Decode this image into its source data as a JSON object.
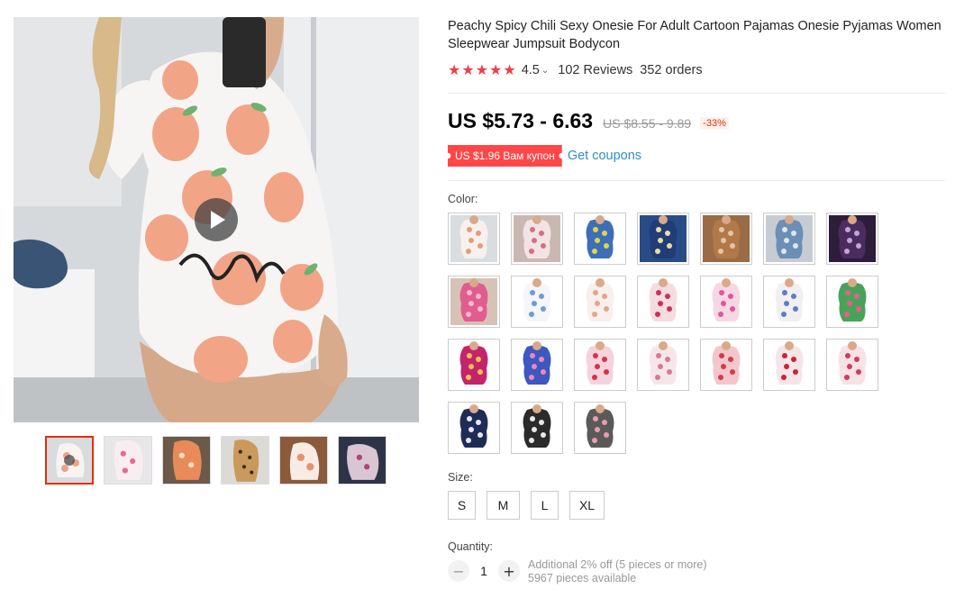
{
  "product": {
    "title": "Peachy Spicy Chili Sexy Onesie For Adult Cartoon Pajamas Onesie Pyjamas Women Sleepwear Jumpsuit Bodycon",
    "rating": "4.5",
    "rating_caret": "⌄",
    "reviews": "102 Reviews",
    "orders": "352 orders",
    "price": "US $5.73 - 6.63",
    "old_price": "US $8.55 - 9.89",
    "discount": "-33%",
    "coupon_badge": "US $1.96 Вам купон",
    "coupon_link": "Get coupons"
  },
  "gallery": {
    "main_image": "peach-print-onesie-photo",
    "play_icon": "play-icon",
    "thumbnails": [
      {
        "name": "peach-white"
      },
      {
        "name": "pink-hearts"
      },
      {
        "name": "orange-pattern"
      },
      {
        "name": "leopard"
      },
      {
        "name": "peach-brown"
      },
      {
        "name": "dark-floral"
      }
    ]
  },
  "options": {
    "color_label": "Color:",
    "colors": [
      {
        "name": "peach-white",
        "main": "#f6f1ee",
        "accent": "#e99a7d",
        "bg": "#d9dde0"
      },
      {
        "name": "pink-print",
        "main": "#f2e4e4",
        "accent": "#d86f7e",
        "bg": "#c9b8b2"
      },
      {
        "name": "blue-floral",
        "main": "#3b6fb8",
        "accent": "#e7d24a",
        "bg": "#ffffff"
      },
      {
        "name": "navy-pattern",
        "main": "#1f3e78",
        "accent": "#f0d9a8",
        "bg": "#2a4c86"
      },
      {
        "name": "brown-floral",
        "main": "#b27948",
        "accent": "#e7c4a1",
        "bg": "#9a6b44"
      },
      {
        "name": "blue-grey",
        "main": "#6b8fb5",
        "accent": "#dfe6ef",
        "bg": "#c7ccd4"
      },
      {
        "name": "purple-glitter",
        "main": "#4b2c5e",
        "accent": "#c8a1d8",
        "bg": "#2c1d3a"
      },
      {
        "name": "pink-donut",
        "main": "#e05d8f",
        "accent": "#f7b8d0",
        "bg": "#d7c3b6"
      },
      {
        "name": "white-blue",
        "main": "#f4f6fa",
        "accent": "#6f9bd6",
        "bg": "#ffffff"
      },
      {
        "name": "white-peach",
        "main": "#f7f0ed",
        "accent": "#e7a48d",
        "bg": "#ffffff"
      },
      {
        "name": "pink-lips",
        "main": "#f5dce0",
        "accent": "#c9315a",
        "bg": "#ffffff"
      },
      {
        "name": "pink-hearts",
        "main": "#f7d7e4",
        "accent": "#e2559a",
        "bg": "#ffffff"
      },
      {
        "name": "white-floral",
        "main": "#f2eff0",
        "accent": "#5a7ec6",
        "bg": "#ffffff"
      },
      {
        "name": "green-pattern",
        "main": "#48a35a",
        "accent": "#f15a8c",
        "bg": "#ffffff"
      },
      {
        "name": "magenta",
        "main": "#c4246b",
        "accent": "#f4c24d",
        "bg": "#ffffff"
      },
      {
        "name": "blue-pink",
        "main": "#3d58c1",
        "accent": "#ef88b9",
        "bg": "#ffffff"
      },
      {
        "name": "pink-red",
        "main": "#f4d3dd",
        "accent": "#d83048",
        "bg": "#ffffff"
      },
      {
        "name": "white-pink",
        "main": "#f6e6ea",
        "accent": "#d67a96",
        "bg": "#ffffff"
      },
      {
        "name": "pink-strawberry",
        "main": "#f3c6cc",
        "accent": "#d13c48",
        "bg": "#ffffff"
      },
      {
        "name": "red-lips",
        "main": "#f4e5e8",
        "accent": "#cc2234",
        "bg": "#ffffff"
      },
      {
        "name": "pink-lips-2",
        "main": "#f7e2e8",
        "accent": "#cf3b63",
        "bg": "#ffffff"
      },
      {
        "name": "navy-stars",
        "main": "#1f2c56",
        "accent": "#e8e6f2",
        "bg": "#ffffff"
      },
      {
        "name": "black-print",
        "main": "#2b2b2b",
        "accent": "#e8e8e8",
        "bg": "#ffffff"
      },
      {
        "name": "grey-hearts",
        "main": "#5a5a5a",
        "accent": "#f09ab2",
        "bg": "#ffffff"
      }
    ],
    "size_label": "Size:",
    "sizes": [
      "S",
      "M",
      "L",
      "XL"
    ],
    "quantity_label": "Quantity:",
    "quantity": "1",
    "qty_minus": "−",
    "qty_plus": "+",
    "qty_note": "Additional 2% off (5 pieces or more)",
    "qty_available": "5967 pieces available"
  },
  "colors": {
    "star": "#f03e4a",
    "price": "#000000",
    "discount": "#e62e04",
    "coupon_bg": "#ff4747",
    "link": "#2e8ec7"
  }
}
